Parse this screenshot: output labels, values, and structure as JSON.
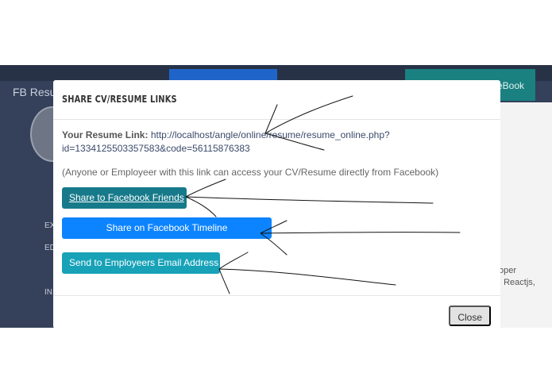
{
  "background": {
    "brand": "FB Resu",
    "teal_button": "eBook",
    "side_labels": [
      "EX",
      "ED",
      "IN"
    ],
    "right_lines": [
      "oper",
      ", Reactjs,"
    ]
  },
  "modal": {
    "title": "SHARE CV/RESUME LINKS",
    "resume_link_label": "Your Resume Link:",
    "resume_link_url": "http://localhost/angle/online/resume/resume_online.php?id=1334125503357583&code=56115876383",
    "note": "(Anyone or Employeer with this link can access your CV/Resume directly from Facebook)",
    "share_friends_label": "Share to Facebook Friends",
    "share_timeline_label": "Share on Facebook Timeline",
    "send_email_label": "Send to Employeers Email Address",
    "close_label": "Close"
  },
  "colors": {
    "backdrop": "#35405a",
    "friends_button": "#177a8a",
    "timeline_button": "#0d84ff",
    "email_button": "#17a2b8"
  }
}
